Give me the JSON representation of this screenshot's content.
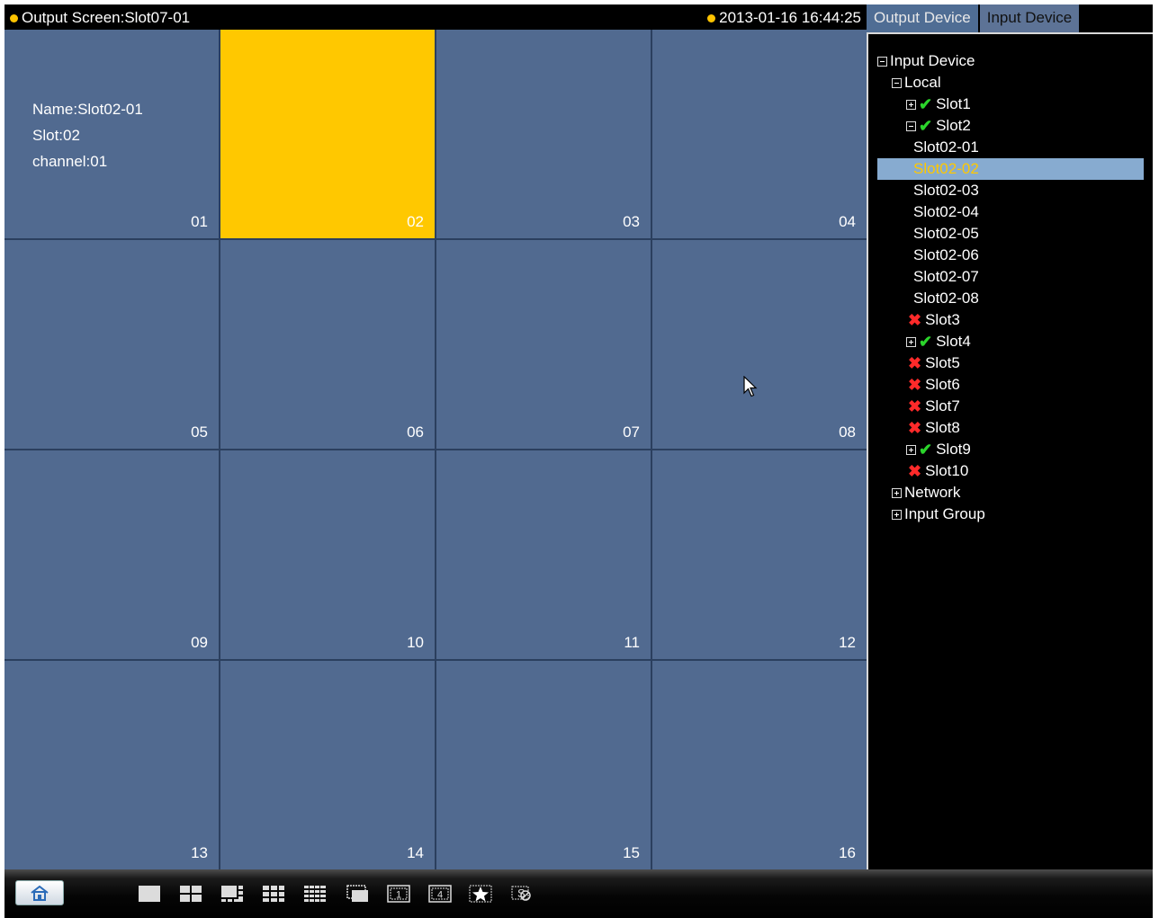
{
  "header": {
    "title": "Output Screen:Slot07-01",
    "datetime": "2013-01-16 16:44:25",
    "status_color": "#ffc400"
  },
  "grid": {
    "selected_cell": "02",
    "cells": [
      {
        "num": "01",
        "info": {
          "name": "Name:Slot02-01",
          "slot": "Slot:02",
          "channel": "channel:01"
        }
      },
      {
        "num": "02"
      },
      {
        "num": "03"
      },
      {
        "num": "04"
      },
      {
        "num": "05"
      },
      {
        "num": "06"
      },
      {
        "num": "07"
      },
      {
        "num": "08"
      },
      {
        "num": "09"
      },
      {
        "num": "10"
      },
      {
        "num": "11"
      },
      {
        "num": "12"
      },
      {
        "num": "13"
      },
      {
        "num": "14"
      },
      {
        "num": "15"
      },
      {
        "num": "16"
      }
    ]
  },
  "panel": {
    "tabs": [
      "Output Device",
      "Input Device"
    ],
    "active_tab": "Output Device",
    "tree": [
      {
        "label": "Input Device",
        "level": 0,
        "toggle": "minus"
      },
      {
        "label": "Local",
        "level": 1,
        "toggle": "minus"
      },
      {
        "label": "Slot1",
        "level": 2,
        "toggle": "plus",
        "status": "ok"
      },
      {
        "label": "Slot2",
        "level": 2,
        "toggle": "minus",
        "status": "ok"
      },
      {
        "label": "Slot02-01",
        "level": 3
      },
      {
        "label": "Slot02-02",
        "level": 3,
        "selected": true
      },
      {
        "label": "Slot02-03",
        "level": 3
      },
      {
        "label": "Slot02-04",
        "level": 3
      },
      {
        "label": "Slot02-05",
        "level": 3
      },
      {
        "label": "Slot02-06",
        "level": 3
      },
      {
        "label": "Slot02-07",
        "level": 3
      },
      {
        "label": "Slot02-08",
        "level": 3
      },
      {
        "label": "Slot3",
        "level": 2,
        "status": "error"
      },
      {
        "label": "Slot4",
        "level": 2,
        "toggle": "plus",
        "status": "ok"
      },
      {
        "label": "Slot5",
        "level": 2,
        "status": "error"
      },
      {
        "label": "Slot6",
        "level": 2,
        "status": "error"
      },
      {
        "label": "Slot7",
        "level": 2,
        "status": "error"
      },
      {
        "label": "Slot8",
        "level": 2,
        "status": "error"
      },
      {
        "label": "Slot9",
        "level": 2,
        "toggle": "plus",
        "status": "ok"
      },
      {
        "label": "Slot10",
        "level": 2,
        "status": "error"
      },
      {
        "label": "Network",
        "level": 1,
        "toggle": "plus"
      },
      {
        "label": "Input Group",
        "level": 1,
        "toggle": "plus"
      }
    ]
  },
  "toolbar": {
    "home_icon": "home-icon",
    "tools": [
      "layout-1-icon",
      "layout-4-icon",
      "layout-6-icon",
      "layout-9-icon",
      "layout-16-icon",
      "window-overlay-icon",
      "screen-1-icon",
      "screen-4-icon",
      "favorite-icon",
      "clear-icon"
    ]
  }
}
